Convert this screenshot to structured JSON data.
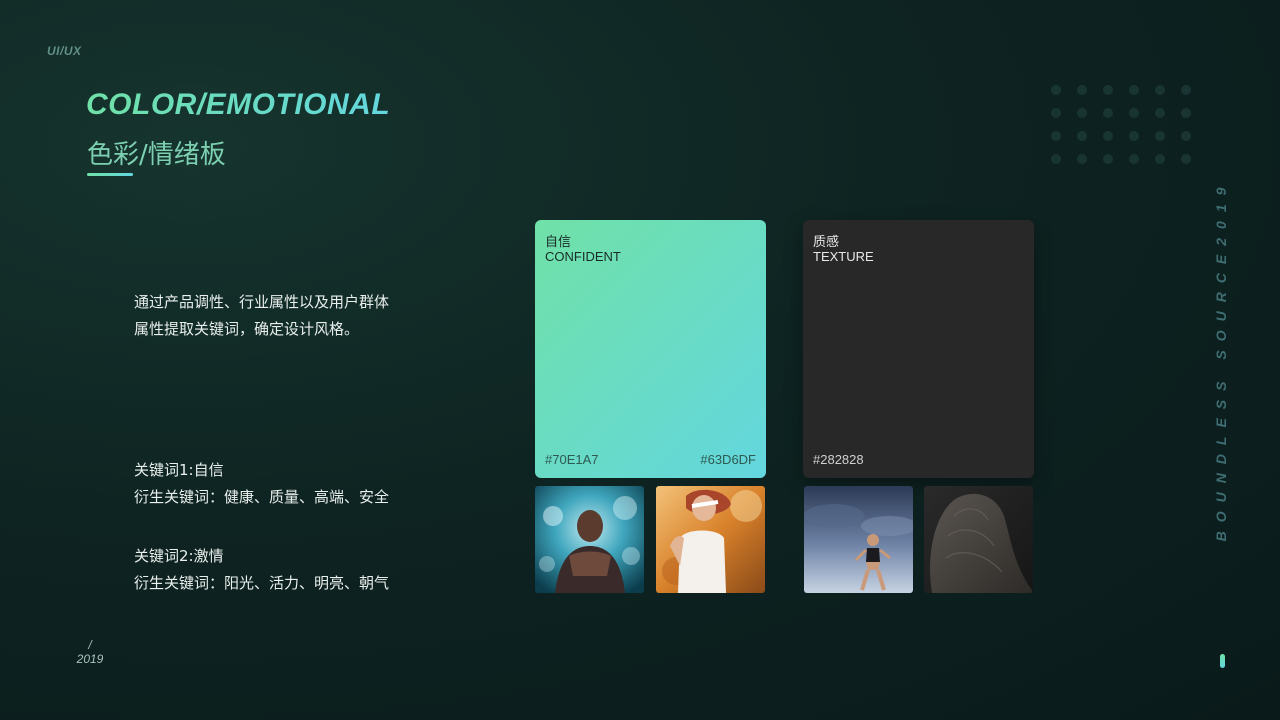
{
  "header": {
    "corner_tag": "UI/UX",
    "title_en": "COLOR/EMOTIONAL",
    "title_cn": "色彩/情绪板"
  },
  "description": {
    "line1": "通过产品调性、行业属性以及用户群体",
    "line2": "属性提取关键词，确定设计风格。"
  },
  "keywords": [
    {
      "keyword": "关键词1:自信",
      "derived": "衍生关键词：健康、质量、高端、安全"
    },
    {
      "keyword": "关键词2:激情",
      "derived": "衍生关键词：阳光、活力、明亮、朝气"
    }
  ],
  "footer": {
    "slash": "/",
    "year": "2019"
  },
  "cards": {
    "confident": {
      "label_cn": "自信",
      "label_en": "CONFIDENT",
      "hex_left": "#70E1A7",
      "hex_right": "#63D6DF"
    },
    "texture": {
      "label_cn": "质感",
      "label_en": "TEXTURE",
      "hex_left": "#282828"
    }
  },
  "side_text": "BOUNDLESS SOURCE2019",
  "colors": {
    "accent_green": "#70E1A7",
    "accent_cyan": "#63D6DF",
    "dark_texture": "#282828"
  }
}
